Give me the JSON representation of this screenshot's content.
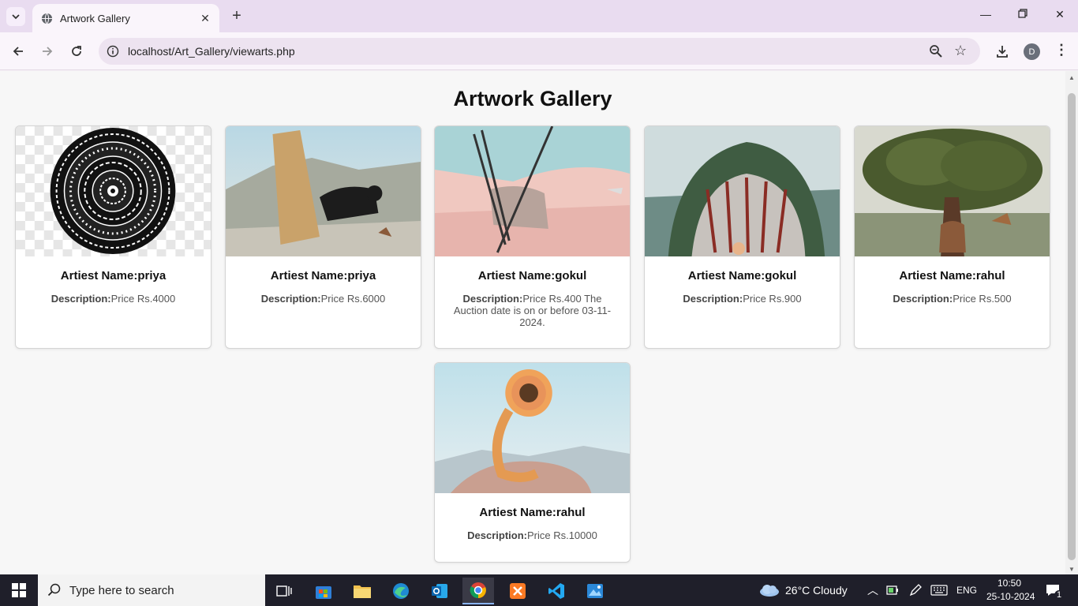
{
  "browser": {
    "tab_title": "Artwork Gallery",
    "url": "localhost/Art_Gallery/viewarts.php",
    "profile_initial": "D"
  },
  "page": {
    "title": "Artwork Gallery",
    "desc_label": "Description:",
    "cards": [
      {
        "artist": "Artiest Name:priya",
        "description": "Price Rs.4000"
      },
      {
        "artist": "Artiest Name:priya",
        "description": "Price Rs.6000"
      },
      {
        "artist": "Artiest Name:gokul",
        "description": "Price Rs.400 The Auction date is on or before 03-11-2024."
      },
      {
        "artist": "Artiest Name:gokul",
        "description": "Price Rs.900"
      },
      {
        "artist": "Artiest Name:rahul",
        "description": "Price Rs.500"
      },
      {
        "artist": "Artiest Name:rahul",
        "description": "Price Rs.10000"
      }
    ]
  },
  "taskbar": {
    "search_placeholder": "Type here to search",
    "weather": "26°C  Cloudy",
    "language": "ENG",
    "time": "10:50",
    "date": "25-10-2024",
    "notification_count": "1"
  },
  "colors": {
    "tab_strip": "#e9dcf0",
    "toolbar": "#faf5fb",
    "omnibox": "#ede3f0",
    "taskbar": "#1f1f2a"
  }
}
